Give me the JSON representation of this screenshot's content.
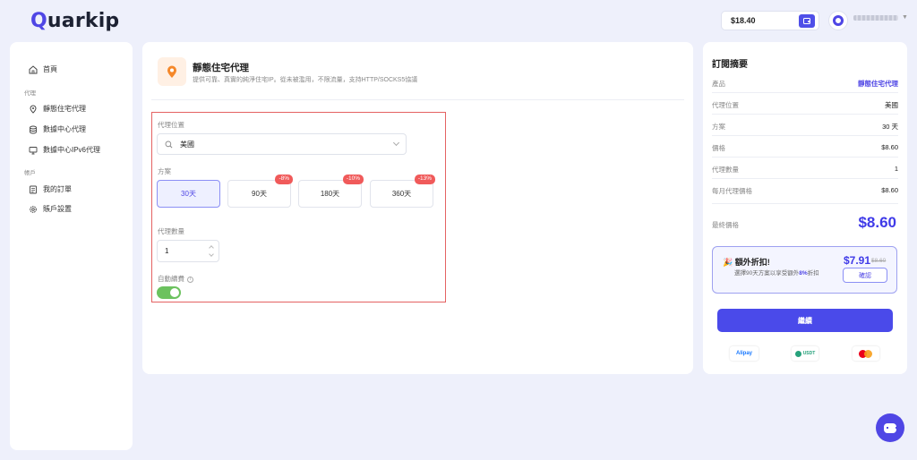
{
  "header": {
    "logo_first": "Q",
    "logo_rest": "uarkip",
    "balance": "$18.40"
  },
  "sidebar": {
    "home": "首頁",
    "group_proxy": "代理",
    "items": [
      "靜態住宅代理",
      "數據中心代理",
      "數據中心IPv6代理"
    ],
    "group_account": "帳戶",
    "account_items": [
      "我的訂單",
      "賬戶設置"
    ]
  },
  "product": {
    "title": "靜態住宅代理",
    "description": "提供可靠、真實的純淨住宅IP。從未被濫用，不限流量，支持HTTP/SOCKS5協議"
  },
  "form": {
    "location_label": "代理位置",
    "location_value": "美國",
    "plan_label": "方案",
    "plans": [
      {
        "label": "30天",
        "discount": ""
      },
      {
        "label": "90天",
        "discount": "-8%"
      },
      {
        "label": "180天",
        "discount": "-10%"
      },
      {
        "label": "360天",
        "discount": "-13%"
      }
    ],
    "selected_plan": 0,
    "quantity_label": "代理數量",
    "quantity_value": "1",
    "auto_renew_label": "自動續費",
    "auto_renew": true
  },
  "summary": {
    "title": "訂閱摘要",
    "rows": [
      {
        "key": "產品",
        "value": "靜態住宅代理"
      },
      {
        "key": "代理位置",
        "value": "美國"
      },
      {
        "key": "方案",
        "value": "30 天"
      },
      {
        "key": "價格",
        "value": "$8.60"
      },
      {
        "key": "代理數量",
        "value": "1"
      },
      {
        "key": "每月代理價格",
        "value": "$8.60"
      }
    ],
    "final_label": "最終價格",
    "final_value": "$8.60",
    "promo": {
      "title": "額外折扣!",
      "subtitle_pre": "選擇90天方案以享受額外",
      "subtitle_pct": "8%",
      "subtitle_post": "折扣",
      "price": "$7.91",
      "old_price": "$8.60",
      "button": "確認"
    },
    "continue_button": "繼續",
    "payments": [
      "Alipay",
      "USDT",
      "mastercard"
    ]
  },
  "colors": {
    "accent": "#4f46e5",
    "danger": "#f05a5a",
    "toggle_on": "#6cc25f"
  }
}
